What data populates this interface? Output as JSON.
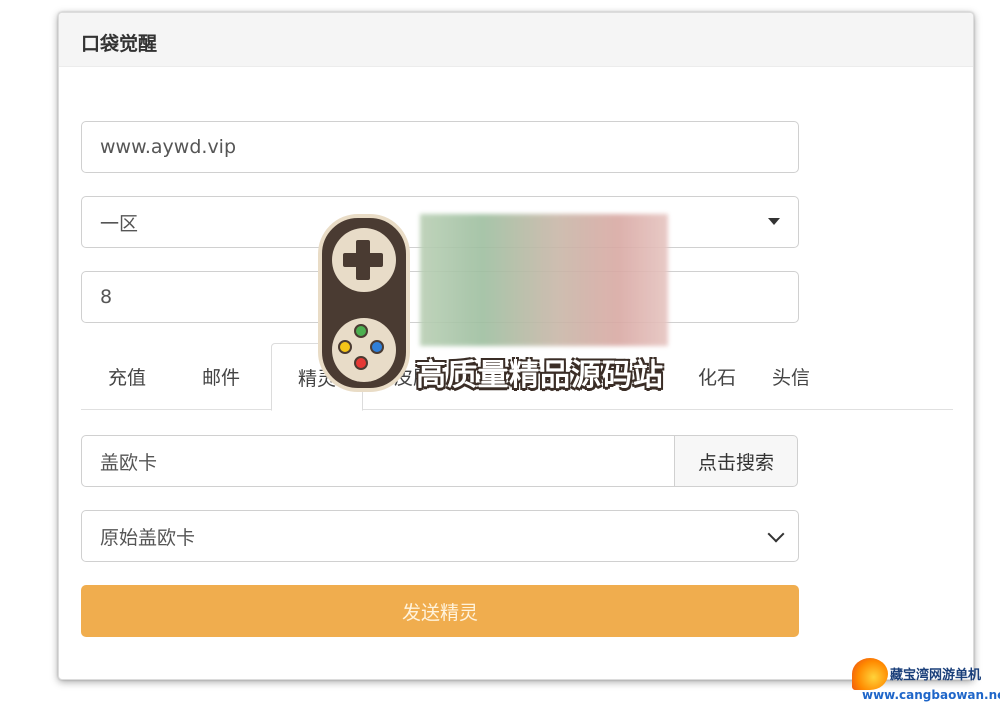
{
  "panel": {
    "title": "口袋觉醒"
  },
  "form": {
    "site_value": "www.aywd.vip",
    "server_select": "一区",
    "role_value": "8"
  },
  "tabs": [
    {
      "label": "充值",
      "active": false
    },
    {
      "label": "邮件",
      "active": false
    },
    {
      "label": "精灵",
      "active": true
    },
    {
      "label": "皮肤",
      "active": false
    },
    {
      "label": "化石",
      "active": false
    },
    {
      "label": "头信",
      "active": false
    }
  ],
  "search": {
    "input_value": "盖欧卡",
    "button_label": "点击搜索"
  },
  "result_select": {
    "value": "原始盖欧卡"
  },
  "send_button": {
    "label": "发送精灵",
    "color": "#f0ad4e"
  },
  "watermark": {
    "title": "高质量精品源码站",
    "corner_name": "藏宝湾网游单机",
    "corner_url": "www.cangbaowan.net"
  }
}
